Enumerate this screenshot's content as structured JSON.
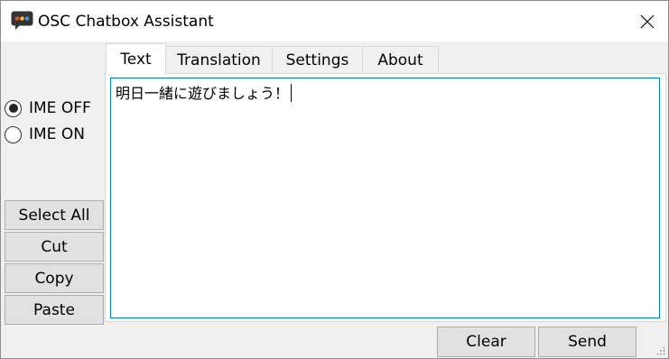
{
  "window": {
    "title": "OSC Chatbox Assistant",
    "icon": "chatbox-assistant-icon"
  },
  "ime": {
    "options": [
      {
        "label": "IME OFF",
        "checked": true
      },
      {
        "label": "IME ON",
        "checked": false
      }
    ]
  },
  "edit_buttons": {
    "select_all": "Select All",
    "cut": "Cut",
    "copy": "Copy",
    "paste": "Paste"
  },
  "tabs": [
    {
      "label": "Text",
      "active": true
    },
    {
      "label": "Translation",
      "active": false
    },
    {
      "label": "Settings",
      "active": false
    },
    {
      "label": "About",
      "active": false
    }
  ],
  "message": {
    "text": "明日一緒に遊びましょう！"
  },
  "actions": {
    "clear": "Clear",
    "send": "Send"
  },
  "colors": {
    "focus_border": "#0078d7",
    "button_bg": "#e1e1e1"
  }
}
